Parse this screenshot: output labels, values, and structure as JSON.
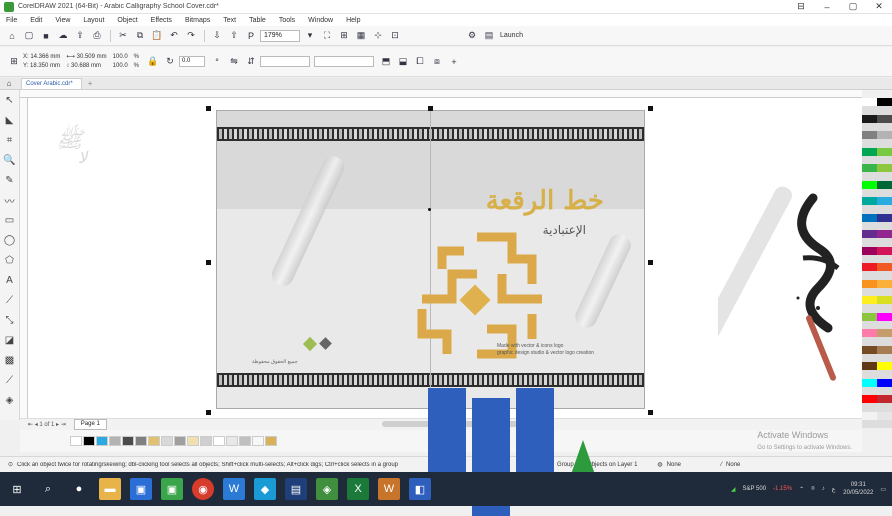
{
  "window": {
    "title": "CorelDRAW 2021 (64-Bit) - Arabic Calligraphy School Cover.cdr*",
    "controls": [
      "⊟",
      "–",
      "▢",
      "✕"
    ]
  },
  "menu": [
    "File",
    "Edit",
    "View",
    "Layout",
    "Object",
    "Effects",
    "Bitmaps",
    "Text",
    "Table",
    "Tools",
    "Window",
    "Help"
  ],
  "toolbar": {
    "zoom": "179%",
    "launch": "Launch",
    "chevron": "▾"
  },
  "property_bar": {
    "x": "X: 14.366 mm",
    "y": "Y: 18.350 mm",
    "w": "⟷ 30.509 mm",
    "h": "↕ 30.688 mm",
    "scale_w": "100.0",
    "scale_h": "100.0",
    "pct": "%",
    "angle": "0.0",
    "units": "°"
  },
  "doc_tab": {
    "label": "Cover Arabic.cdr*",
    "add": "+"
  },
  "artwork": {
    "title": "خط الرقعة",
    "subtitle": "الإعتبادية",
    "credit_left": "جميع الحقوق محفوظة",
    "credit_right_1": "Made with vector & icons logo",
    "credit_right_2": "graphic design studio & vector logo creation"
  },
  "pager": {
    "nav": "⇤ ◂ 1 of 1 ▸ ⇥",
    "page": "Page 1"
  },
  "status": {
    "hint": "Click an object twice for rotating/skewing; dbl-clicking tool selects all objects; Shift+click multi-selects; Alt+click digs; Ctrl+click selects in a group",
    "object": "Group of 8 Objects on Layer 1",
    "fill": "None",
    "outline": "None"
  },
  "watermark": {
    "line1": "Activate Windows",
    "line2": "Go to Settings to activate Windows."
  },
  "taskbar": {
    "ticker": "S&P 500",
    "change": "-1.15%",
    "time": "09:31",
    "date": "20/05/2022"
  },
  "palette_colors": [
    "#ffffff",
    "#000000",
    "#1a1a1a",
    "#4c4c4c",
    "#808080",
    "#b3b3b3",
    "#00a651",
    "#7ac943",
    "#39b54a",
    "#8dc63f",
    "#00ff00",
    "#006837",
    "#00a99d",
    "#29abe2",
    "#0071bc",
    "#2e3192",
    "#662d91",
    "#92278f",
    "#9e005d",
    "#d4145a",
    "#ed1c24",
    "#f15a24",
    "#f7931e",
    "#fbb03b",
    "#fcee21",
    "#d9e021",
    "#8cc63f",
    "#ff00ff",
    "#ff7bac",
    "#c69c6d",
    "#754c24",
    "#a67c52",
    "#603813",
    "#ffff00",
    "#00ffff",
    "#0000ff",
    "#ff0000",
    "#c1272d",
    "#f2f2f2",
    "#e6e6e6"
  ],
  "doc_palette": [
    "#ffffff",
    "#000000",
    "#29abe2",
    "#b3b3b3",
    "#4c4c4c",
    "#808080",
    "#e0c170",
    "#d8d8d8",
    "#a0a0a0",
    "#f0e0b0",
    "#cfcfcf",
    "#ffffff",
    "#e8e8e8",
    "#c0c0c0",
    "#f7f7f7",
    "#d6b25a"
  ]
}
